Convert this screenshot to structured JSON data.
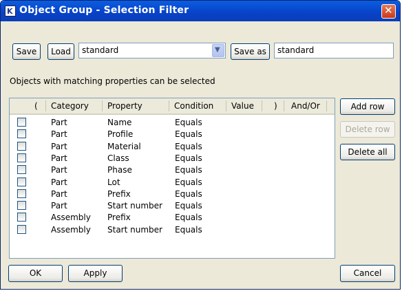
{
  "window": {
    "title": "Object Group - Selection Filter"
  },
  "toolbar": {
    "save_label": "Save",
    "load_label": "Load",
    "preset_value": "standard",
    "save_as_label": "Save as",
    "save_as_value": "standard"
  },
  "hint": "Objects with matching properties can be selected",
  "grid": {
    "headers": {
      "open_paren": "(",
      "category": "Category",
      "property": "Property",
      "condition": "Condition",
      "value": "Value",
      "close_paren": ")",
      "and_or": "And/Or"
    },
    "rows": [
      {
        "category": "Part",
        "property": "Name",
        "condition": "Equals"
      },
      {
        "category": "Part",
        "property": "Profile",
        "condition": "Equals"
      },
      {
        "category": "Part",
        "property": "Material",
        "condition": "Equals"
      },
      {
        "category": "Part",
        "property": "Class",
        "condition": "Equals"
      },
      {
        "category": "Part",
        "property": "Phase",
        "condition": "Equals"
      },
      {
        "category": "Part",
        "property": "Lot",
        "condition": "Equals"
      },
      {
        "category": "Part",
        "property": "Prefix",
        "condition": "Equals"
      },
      {
        "category": "Part",
        "property": "Start number",
        "condition": "Equals"
      },
      {
        "category": "Assembly",
        "property": "Prefix",
        "condition": "Equals"
      },
      {
        "category": "Assembly",
        "property": "Start number",
        "condition": "Equals"
      }
    ]
  },
  "side_buttons": {
    "add_row": "Add row",
    "delete_row": "Delete row",
    "delete_all": "Delete all"
  },
  "footer": {
    "ok": "OK",
    "apply": "Apply",
    "cancel": "Cancel"
  },
  "icons": {
    "app": "tekla-app-icon",
    "close": "close-icon",
    "dropdown": "chevron-down-icon"
  },
  "colors": {
    "titlebar": "#0842c8",
    "dialog_bg": "#ece9d8",
    "close_button": "#c8391b"
  }
}
